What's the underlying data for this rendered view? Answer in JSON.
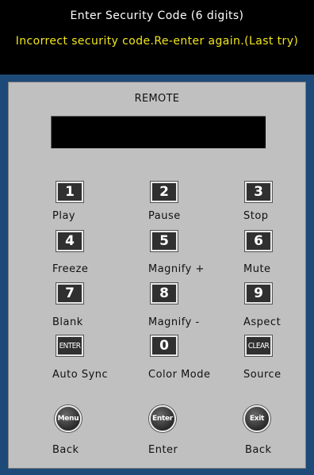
{
  "header": {
    "title": "Enter Security Code (6 digits)",
    "warning": "Incorrect security code.Re-enter again.(Last try)"
  },
  "colors": {
    "background": "#000000",
    "warning_text": "#f2e61c",
    "frame": "#1d4a78",
    "panel": "#c0c0c0"
  },
  "remote": {
    "title": "REMOTE",
    "display_value": "",
    "keys": [
      {
        "key": "1",
        "label": "Play"
      },
      {
        "key": "2",
        "label": "Pause"
      },
      {
        "key": "3",
        "label": "Stop"
      },
      {
        "key": "4",
        "label": "Freeze"
      },
      {
        "key": "5",
        "label": "Magnify +"
      },
      {
        "key": "6",
        "label": "Mute"
      },
      {
        "key": "7",
        "label": "Blank"
      },
      {
        "key": "8",
        "label": "Magnify -"
      },
      {
        "key": "9",
        "label": "Aspect"
      },
      {
        "key": "ENTER",
        "label": "Auto Sync"
      },
      {
        "key": "0",
        "label": "Color Mode"
      },
      {
        "key": "CLEAR",
        "label": "Source"
      }
    ],
    "round_buttons": [
      {
        "key": "Menu",
        "label": "Back"
      },
      {
        "key": "Enter",
        "label": "Enter"
      },
      {
        "key": "Exit",
        "label": "Back"
      }
    ]
  }
}
